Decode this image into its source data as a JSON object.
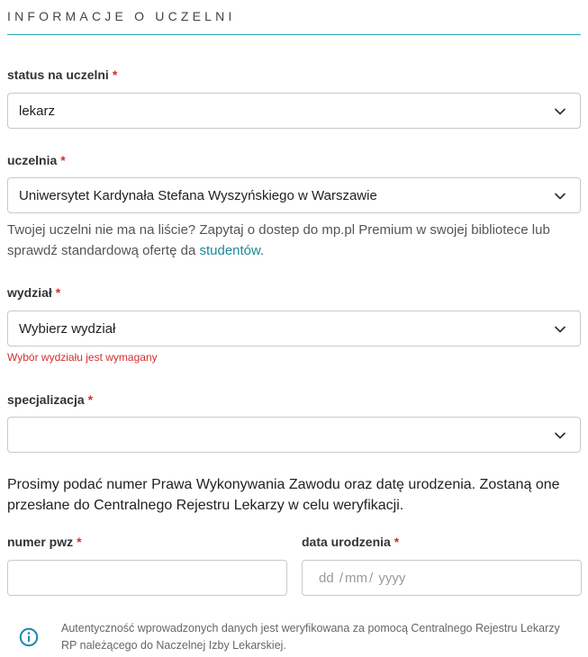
{
  "section": {
    "title": "INFORMACJE O UCZELNI"
  },
  "status": {
    "label": "status na uczelni",
    "required": "*",
    "value": "lekarz"
  },
  "university": {
    "label": "uczelnia",
    "required": "*",
    "value": "Uniwersytet Kardynała Stefana Wyszyńskiego w Warszawie",
    "hint_text": "Twojej uczelni nie ma na liście? Zapytaj o dostep do mp.pl Premium w swojej bibliotece lub sprawdź standardową ofertę da ",
    "hint_link": "studentów",
    "hint_end": "."
  },
  "faculty": {
    "label": "wydział",
    "required": "*",
    "placeholder": "Wybierz wydział",
    "error": "Wybór wydziału jest wymagany"
  },
  "specialization": {
    "label": "specjalizacja",
    "required": "*",
    "value": ""
  },
  "verification": {
    "prompt": "Prosimy podać numer Prawa Wykonywania Zawodu oraz datę urodzenia. Zostaną one przesłane do Centralnego Rejestru Lekarzy w celu weryfikacji."
  },
  "pwz": {
    "label": "numer pwz",
    "required": "*",
    "value": ""
  },
  "birthdate": {
    "label": "data urodzenia",
    "required": "*",
    "day": "dd",
    "sep1": "/",
    "month": "mm",
    "sep2": "/",
    "year": "yyyy"
  },
  "info": {
    "icon": "info-circle-icon",
    "text": "Autentyczność wprowadzonych danych jest weryfikowana za pomocą Centralnego Rejestru Lekarzy RP należącego do Naczelnej Izby Lekarskiej."
  },
  "colors": {
    "accent": "#2aa3b8",
    "link": "#1a8a9a",
    "error": "#d32f2f",
    "info_icon": "#1a8ab0"
  }
}
